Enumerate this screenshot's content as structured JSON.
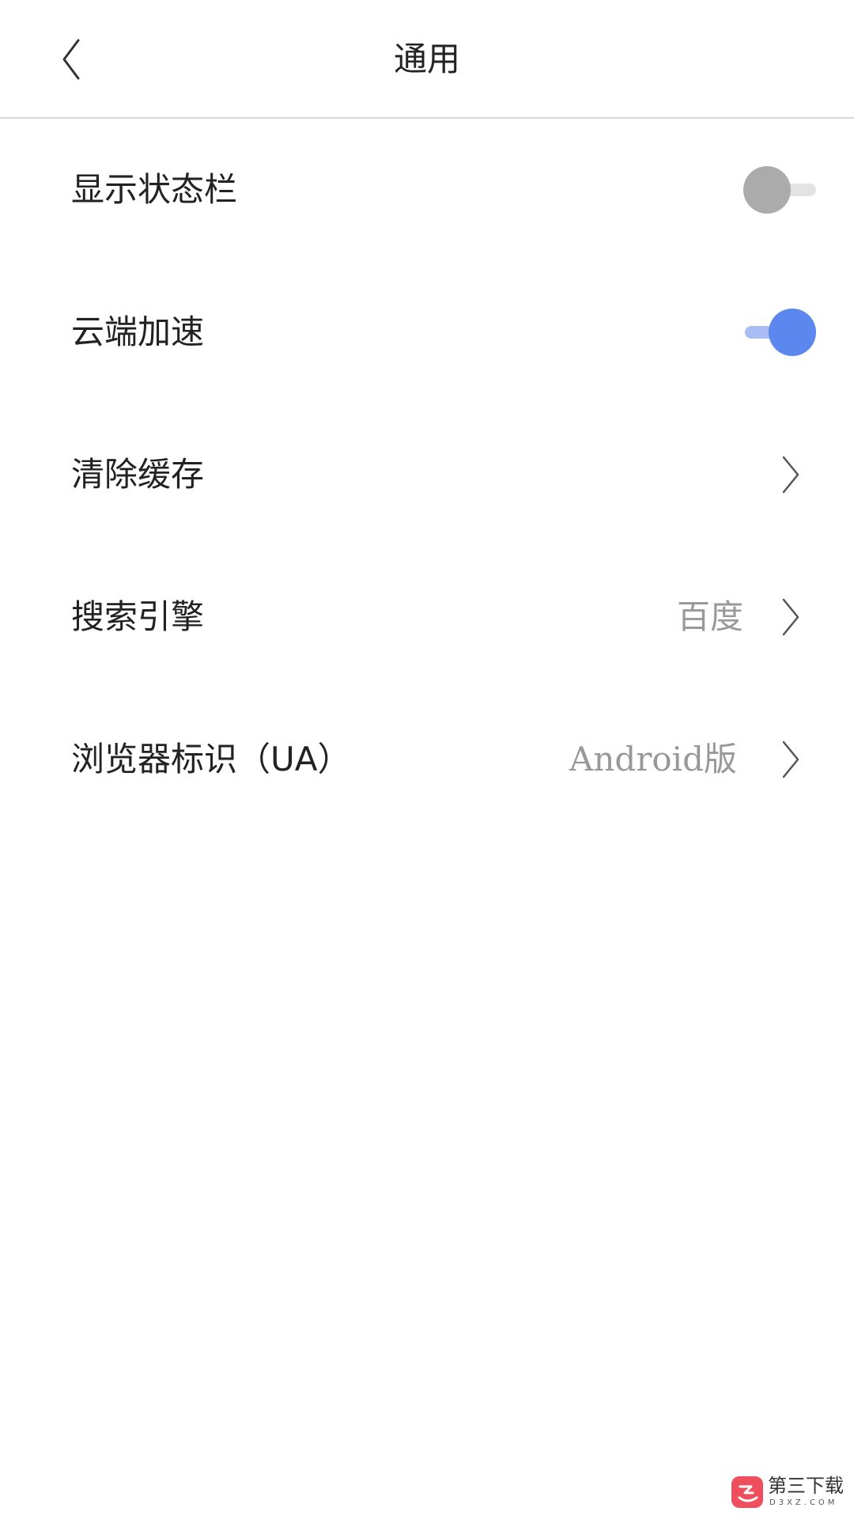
{
  "header": {
    "title": "通用",
    "back_icon": "chevron-left-icon"
  },
  "settings": [
    {
      "label": "显示状态栏",
      "type": "toggle",
      "checked": false
    },
    {
      "label": "云端加速",
      "type": "toggle",
      "checked": true
    },
    {
      "label": "清除缓存",
      "type": "link",
      "value": ""
    },
    {
      "label": "搜索引擎",
      "type": "link",
      "value": "百度"
    },
    {
      "label": "浏览器标识（UA）",
      "type": "link",
      "value": "Android版"
    }
  ],
  "colors": {
    "toggle_on": "#5b87ee",
    "toggle_off": "#ababab",
    "value_text": "#999999",
    "divider": "#d9d9d9"
  },
  "watermark": {
    "brand": "第三下载",
    "sub": "D3XZ.COM"
  }
}
